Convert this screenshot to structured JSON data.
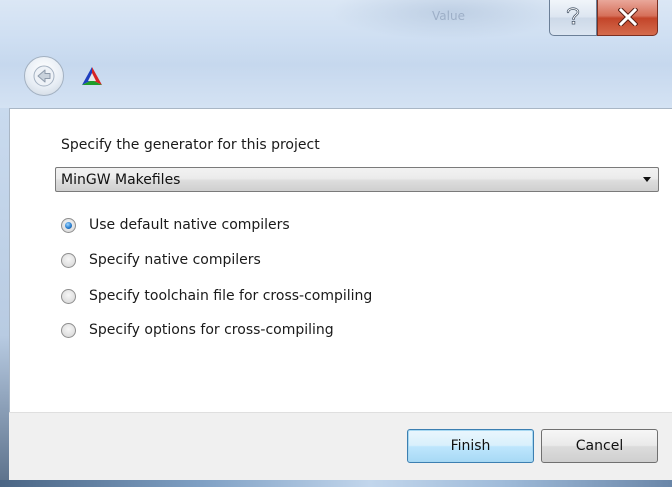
{
  "window": {
    "title": "Value"
  },
  "toolbar": {
    "back_icon": "back-arrow-icon",
    "logo_icon": "cmake-logo-icon"
  },
  "generator": {
    "prompt": "Specify the generator for this project",
    "selected": "MinGW Makefiles"
  },
  "compiler_options": [
    {
      "label": "Use default native compilers",
      "checked": true
    },
    {
      "label": "Specify native compilers",
      "checked": false
    },
    {
      "label": "Specify toolchain file for cross-compiling",
      "checked": false
    },
    {
      "label": "Specify options for cross-compiling",
      "checked": false
    }
  ],
  "buttons": {
    "finish": "Finish",
    "cancel": "Cancel"
  },
  "colors": {
    "accent": "#3c7fb1",
    "close": "#c3452a"
  }
}
